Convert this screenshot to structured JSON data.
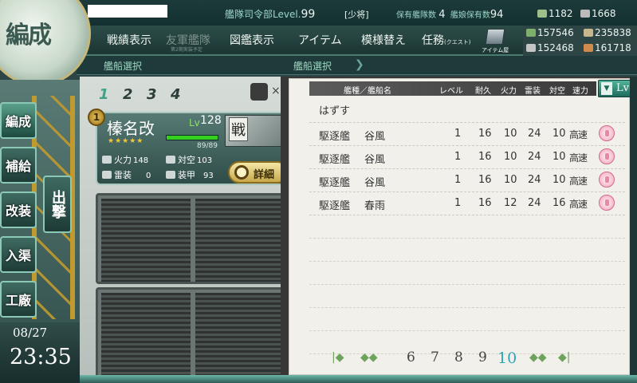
{
  "header": {
    "admiral_label": "艦隊司令部Level.",
    "admiral_level": "99",
    "rank": "[少将]",
    "ships_label": "保有艦隊数",
    "ships_value": "4",
    "girls_label": "艦娘保有数",
    "girls_value": "94"
  },
  "nav": {
    "fleet_view": "戦績表示",
    "ally_fleet": "友軍艦隊",
    "ally_sub": "第2期実装予定",
    "encyclopedia": "図鑑表示",
    "items": "アイテム",
    "furniture": "模様替え",
    "quests": "任務",
    "quests_sub": "(クエスト)",
    "item_shop": "アイテム屋"
  },
  "resources": {
    "bucket": "1182",
    "fuel": "157546",
    "steel": "152468",
    "devmat": "1668",
    "ammo": "235838",
    "bauxite": "161718"
  },
  "sub_header": {
    "left": "艦船選択",
    "right": "艦船選択"
  },
  "emblem": "編成",
  "side_menu": {
    "henshu": "編成",
    "hokyu": "補給",
    "kaiso": "改装",
    "nyukyo": "入渠",
    "kosho": "工廠",
    "shutsugeki": "出撃"
  },
  "clock": {
    "date": "08/27",
    "time": "23:35"
  },
  "fleet": {
    "tabs": [
      "1",
      "2",
      "3",
      "4"
    ],
    "active_tab": "1",
    "flag_number": "1",
    "ship": {
      "name": "榛名改",
      "lv_label": "Lv",
      "lv": "128",
      "stars": "★★★★★",
      "hp": "89/89",
      "hp_fraction": 1.0,
      "thumb_tag": "戦",
      "firepower_label": "火力",
      "firepower": "148",
      "aa_label": "対空",
      "aa": "103",
      "torpedo_label": "雷装",
      "torpedo": "0",
      "armor_label": "装甲",
      "armor": "93",
      "detail_label": "詳細"
    }
  },
  "list": {
    "headers": {
      "type_name": "艦種／艦船名",
      "level": "レベル",
      "hp": "耐久",
      "firepower": "火力",
      "torpedo": "雷装",
      "aa": "対空",
      "speed": "速力"
    },
    "sort_label": "Lv",
    "sort_arrow": "▼",
    "remove_label": "はずす",
    "rows": [
      {
        "type": "駆逐艦",
        "name": "谷風",
        "level": "1",
        "hp": "16",
        "fp": "10",
        "tp": "24",
        "aa": "10",
        "speed": "高速"
      },
      {
        "type": "駆逐艦",
        "name": "谷風",
        "level": "1",
        "hp": "16",
        "fp": "10",
        "tp": "24",
        "aa": "10",
        "speed": "高速"
      },
      {
        "type": "駆逐艦",
        "name": "谷風",
        "level": "1",
        "hp": "16",
        "fp": "10",
        "tp": "24",
        "aa": "10",
        "speed": "高速"
      },
      {
        "type": "駆逐艦",
        "name": "春雨",
        "level": "1",
        "hp": "16",
        "fp": "12",
        "tp": "24",
        "aa": "16",
        "speed": "高速"
      }
    ],
    "pages": [
      "6",
      "7",
      "8",
      "9",
      "10"
    ],
    "current_page": "10",
    "first_arrow": "|◆",
    "prev_arrow": "◆◆",
    "next_arrow": "◆◆",
    "last_arrow": "◆|"
  }
}
